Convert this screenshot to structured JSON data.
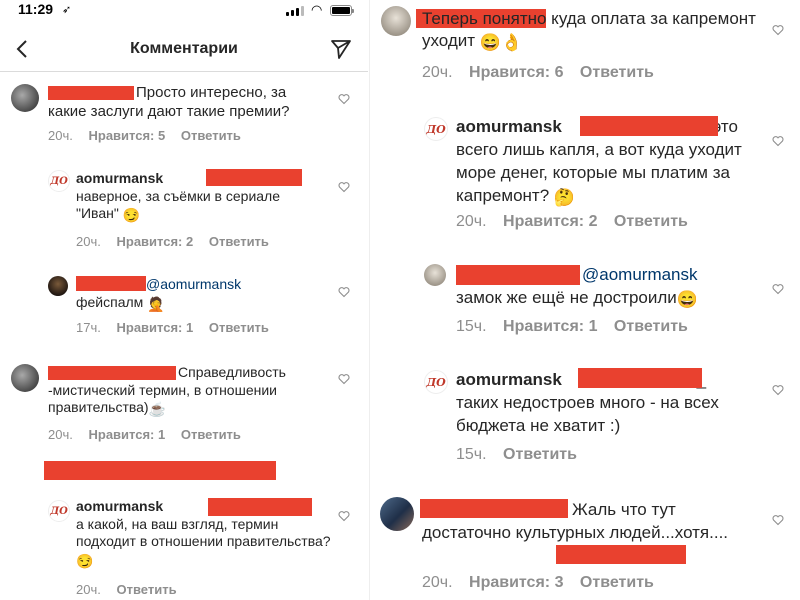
{
  "status_bar": {
    "time": "11:29",
    "location_glyph": "➶"
  },
  "header": {
    "title": "Комментарии",
    "back_icon": "chevron-left-icon",
    "send_icon": "paper-plane-icon"
  },
  "colors": {
    "redaction": "#e9412f",
    "mention": "#00376b",
    "meta": "#8e8e8e",
    "text": "#262626"
  },
  "reply_label": "Ответить",
  "left": {
    "c1": {
      "text": "Просто интересно, за какие заслуги дают такие премии?",
      "time": "20ч.",
      "likes": "Нравится: 5"
    },
    "c2": {
      "user": "aomurmansk",
      "text": "наверное, за съёмки в сериале \"Иван\"",
      "emoji": "😏",
      "time": "20ч.",
      "likes": "Нравится: 2"
    },
    "c3": {
      "mention": "@aomurmansk",
      "text": "фейспалм",
      "emoji": "🤦",
      "time": "17ч.",
      "likes": "Нравится: 1"
    },
    "c4": {
      "text_line1": "Справедливость",
      "text_rest": "-мистический термин, в отношении правительства)",
      "emoji": "☕",
      "time": "20ч.",
      "likes": "Нравится: 1"
    },
    "c5": {
      "user": "aomurmansk",
      "text": "а какой, на ваш взгляд, термин подходит в отношении правительства?",
      "emoji": "😏",
      "time": "20ч."
    }
  },
  "right": {
    "c1": {
      "text": "Теперь понятно куда оплата за капремонт уходит",
      "emoji": "😄👌",
      "time": "20ч.",
      "likes": "Нравится: 6"
    },
    "c2": {
      "user": "aomurmansk",
      "text_tail": "это",
      "text": "всего лишь капля, а вот куда уходит море денег, которые мы платим за капремонт?",
      "emoji": "🤔",
      "time": "20ч.",
      "likes": "Нравится: 2"
    },
    "c3": {
      "mention": "@aomurmansk",
      "text": "замок же ещё не достроили",
      "emoji": "😄",
      "time": "15ч.",
      "likes": "Нравится: 1"
    },
    "c4": {
      "user": "aomurmansk",
      "tail": "_",
      "text": "таких недостроев много - на всех бюджета не хватит :)",
      "time": "15ч."
    },
    "c5": {
      "text_line1": "Жаль что тут",
      "text_rest": "достаточно культурных людей...хотя....",
      "time": "20ч.",
      "likes": "Нравится: 3"
    }
  }
}
